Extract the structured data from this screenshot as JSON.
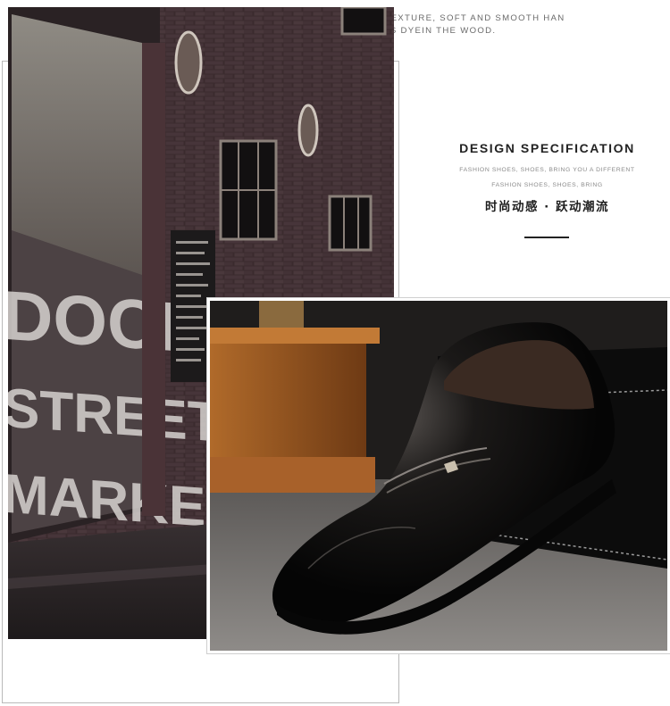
{
  "header": {
    "line1": "SELECTION OF HIGH QUALITY LEATHER, IT DETAILED TEXTURE, SOFT AND SMOOTH HAN",
    "line2": "DLE, GOOD TOUGHNESS, PERMEABILITY IS DYEIN THE WOOD."
  },
  "spec": {
    "title": "DESIGN SPECIFICATION",
    "sub1": "FASHION SHOES, SHOES, BRING YOU A DIFFERENT",
    "sub2": "FASHION SHOES, SHOES, BRING",
    "cn": "时尚动感 · 跃动潮流"
  },
  "storefront": {
    "line1": "DOCK",
    "line2": "STREET",
    "line3": "MARKET"
  },
  "colors": {
    "brick": "#3a2a2c",
    "leather": "#0e0c0b",
    "table_wood": "#9a5a22"
  }
}
